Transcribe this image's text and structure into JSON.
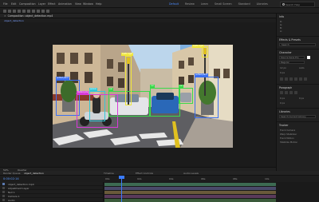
{
  "app": {
    "menu": [
      "File",
      "Edit",
      "Composition",
      "Layer",
      "Effect",
      "Animation",
      "View",
      "Window",
      "Help"
    ],
    "workspaces": [
      "Default",
      "Review",
      "Learn",
      "Small Screen",
      "Standard",
      "Libraries"
    ],
    "active_workspace_index": 0,
    "search_label": "Search Help"
  },
  "composition": {
    "tab_label": "Composition: object_detection.mp4",
    "breadcrumb": "object_detection"
  },
  "viewer": {
    "zoom": "50%",
    "quality": "Quarter"
  },
  "detections": [
    {
      "label": "potted plant",
      "color": "#3b6ff0"
    },
    {
      "label": "potted plant",
      "color": "#3b6ff0"
    },
    {
      "label": "person",
      "color": "#33c8d8"
    },
    {
      "label": "motorcycle",
      "color": "#d93ad9"
    },
    {
      "label": "car",
      "color": "#3ad94a"
    },
    {
      "label": "car",
      "color": "#3ad94a"
    },
    {
      "label": "car",
      "color": "#3ad94a"
    },
    {
      "label": "traffic light",
      "color": "#f0e63a"
    },
    {
      "label": "traffic light",
      "color": "#f0e63a"
    }
  ],
  "timeline": {
    "tabs": [
      "Render Queue",
      "object_detection",
      "Timeline",
      "Effect Controls",
      "Audio Levels"
    ],
    "time": "0:00:02:14",
    "ruler_labels": [
      "00s",
      "02s",
      "04s",
      "06s",
      "08s",
      "10s"
    ],
    "layers": [
      "object_detection.mp4",
      "Adjustment Layer",
      "Null 1",
      "Camera 1",
      "Audio"
    ]
  },
  "right_panel": {
    "sections": [
      {
        "title": "Info",
        "rows": [
          "R:",
          "G:",
          "B:",
          "A:"
        ]
      },
      {
        "title": "Effects & Presets",
        "rows": [
          "Search"
        ]
      },
      {
        "title": "Character",
        "rows": [
          "Source Sans Pro",
          "Regular",
          "12 px",
          "Auto",
          "0 px"
        ]
      },
      {
        "title": "Paragraph",
        "rows": [
          "0 px",
          "0 px",
          "0 px"
        ]
      },
      {
        "title": "Libraries",
        "rows": [
          "Search Current Library"
        ]
      },
      {
        "title": "Tracker",
        "rows": [
          "Track Camera",
          "Warp Stabilizer",
          "Track Motion",
          "Stabilize Motion"
        ]
      }
    ]
  }
}
